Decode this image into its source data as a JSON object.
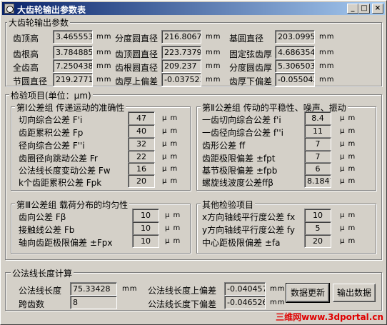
{
  "window": {
    "title": "大齿轮输出参数表",
    "minimize": "_",
    "maximize": "□",
    "close": "×"
  },
  "output_group": {
    "title": "大齿轮输出参数",
    "rows": [
      [
        {
          "label": "齿顶高",
          "value": "3.465553",
          "unit": "mm"
        },
        {
          "label": "分度圆直径",
          "value": "216.8067",
          "unit": "mm"
        },
        {
          "label": "基圆直径",
          "value": "203.0995",
          "unit": "mm"
        }
      ],
      [
        {
          "label": "齿根高",
          "value": "3.784885",
          "unit": "mm"
        },
        {
          "label": "齿顶圆直径",
          "value": "223.7379",
          "unit": "mm"
        },
        {
          "label": "固定弦齿厚",
          "value": "4.686354",
          "unit": "mm"
        }
      ],
      [
        {
          "label": "全齿高",
          "value": "7.250438",
          "unit": "mm"
        },
        {
          "label": "齿根圆直径",
          "value": "209.237",
          "unit": "mm"
        },
        {
          "label": "分度圆齿厚",
          "value": "5.306503",
          "unit": "mm"
        }
      ],
      [
        {
          "label": "节圆直径",
          "value": "219.2771",
          "unit": "mm"
        },
        {
          "label": "齿厚上偏差",
          "value": "-0.037523",
          "unit": "mm"
        },
        {
          "label": "齿厚下偏差",
          "value": "-0.055042",
          "unit": "mm"
        }
      ]
    ]
  },
  "inspection_group": {
    "title": "检验项目(单位：μm)",
    "group1": {
      "title": "第Ⅰ公差组 传递运动的准确性",
      "items": [
        {
          "label": "切向综合公差 F'i",
          "value": "47",
          "unit": "μ m"
        },
        {
          "label": "齿距累积公差 Fp",
          "value": "40",
          "unit": "μ m"
        },
        {
          "label": "径向综合公差 F''i",
          "value": "32",
          "unit": "μ m"
        },
        {
          "label": "齿圈径向跳动公差 Fr",
          "value": "22",
          "unit": "μ m"
        },
        {
          "label": "公法线长度变动公差 Fw",
          "value": "16",
          "unit": "μ m"
        },
        {
          "label": "k个齿距累积公差 Fpk",
          "value": "20",
          "unit": "μ m"
        }
      ]
    },
    "group2": {
      "title": "第Ⅱ公差组 传动的平稳性、噪声、振动",
      "items": [
        {
          "label": "一齿切向综合公差 f'i",
          "value": "8.4",
          "unit": "μ m"
        },
        {
          "label": "一齿径向综合公差 f''i",
          "value": "11",
          "unit": "μ m"
        },
        {
          "label": "齿形公差 ff",
          "value": "7",
          "unit": "μ m"
        },
        {
          "label": "齿距极限偏差 ±fpt",
          "value": "7",
          "unit": "μ m"
        },
        {
          "label": "基节极限偏差 ±fpb",
          "value": "6",
          "unit": "μ m"
        },
        {
          "label": "螺旋线波度公差ffβ",
          "value": "8.1847",
          "unit": "μ m"
        }
      ]
    },
    "group3": {
      "title": "第Ⅲ公差组 载荷分布的均匀性",
      "items": [
        {
          "label": "齿向公差 Fβ",
          "value": "10",
          "unit": "μ m"
        },
        {
          "label": "接触线公差 Fb",
          "value": "10",
          "unit": "μ m"
        },
        {
          "label": "轴向齿距极限偏差 ±Fpx",
          "value": "10",
          "unit": "μ m"
        }
      ]
    },
    "group4": {
      "title": "其他检验项目",
      "items": [
        {
          "label": "x方向轴线平行度公差 fx",
          "value": "10",
          "unit": "μ m"
        },
        {
          "label": "y方向轴线平行度公差 fy",
          "value": "5",
          "unit": "μ m"
        },
        {
          "label": "中心距极限偏差 ±fa",
          "value": "20",
          "unit": "μ m"
        }
      ]
    }
  },
  "wkl_group": {
    "title": "公法线长度计算",
    "length_label": "公法线长度",
    "length_value": "75.33428",
    "length_unit": "mm",
    "span_label": "跨齿数",
    "span_value": "8",
    "upper_label": "公法线长度上偏差",
    "upper_value": "-0.040457",
    "upper_unit": "mm",
    "lower_label": "公法线长度下偏差",
    "lower_value": "-0.046526",
    "lower_unit": "mm"
  },
  "buttons": {
    "update": "数据更新",
    "export": "输出数据"
  },
  "watermark": "三维网www.3dportal.cn"
}
